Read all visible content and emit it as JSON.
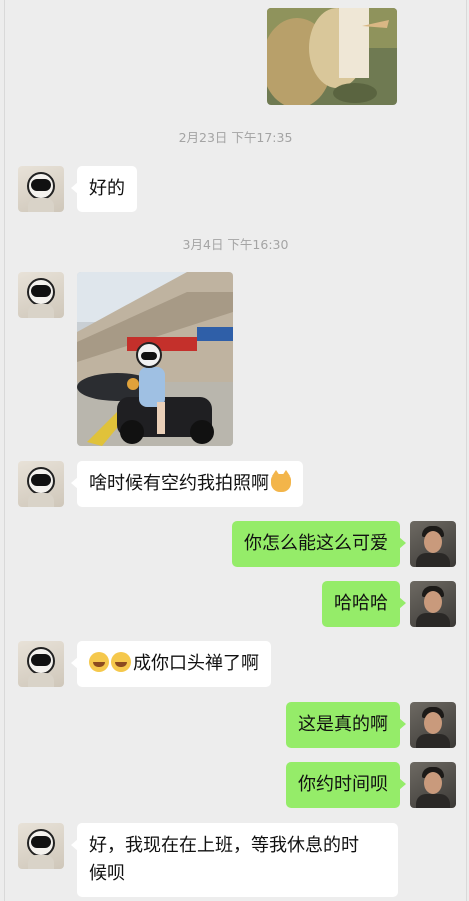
{
  "timestamps": [
    "2月23日 下午17:35",
    "3月4日 下午16:30"
  ],
  "messages": [
    {
      "side": "left",
      "type": "image",
      "subject": "portrait photo, person by plants"
    },
    {
      "side": "left",
      "type": "text",
      "text": "好的"
    },
    {
      "side": "left",
      "type": "image",
      "subject": "person in white helmet on motorcycle, storefront street"
    },
    {
      "side": "left",
      "type": "text",
      "text": "啥时候有空约我拍照啊",
      "trailing_icon": "cat-face-icon"
    },
    {
      "side": "right",
      "type": "text",
      "text": "你怎么能这么可爱"
    },
    {
      "side": "right",
      "type": "text",
      "text": "哈哈哈"
    },
    {
      "side": "left",
      "type": "text",
      "text": "成你口头禅了啊",
      "leading_icons": [
        "tears-of-joy-emoji-icon",
        "tears-of-joy-emoji-icon"
      ]
    },
    {
      "side": "right",
      "type": "text",
      "text": "这是真的啊"
    },
    {
      "side": "right",
      "type": "text",
      "text": "你约时间呗"
    },
    {
      "side": "left",
      "type": "text",
      "lines": [
        "好，我现在在上班，等我休息的时",
        "候呗"
      ]
    }
  ],
  "colors": {
    "background": "#ededed",
    "left_bubble": "#ffffff",
    "right_bubble": "#95ec69",
    "timestamp": "#a4a4a4"
  }
}
